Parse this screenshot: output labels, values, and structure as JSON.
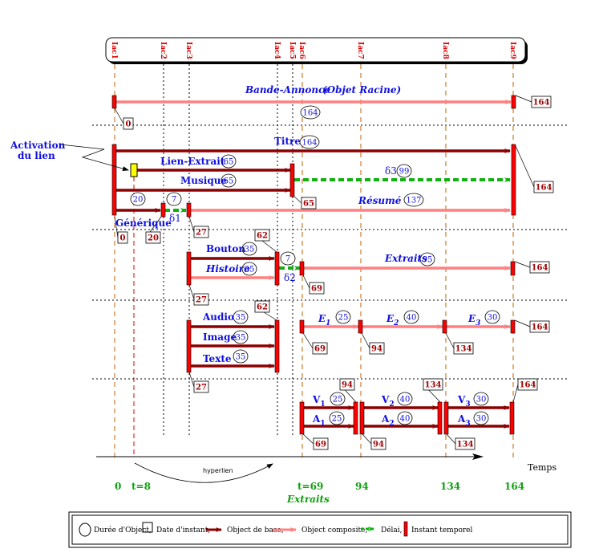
{
  "timeline": {
    "iac": [
      "Iac1",
      "Iac2",
      "Iac3",
      "Iac4",
      "Iac5",
      "Iac6",
      "Iac7",
      "Iac8",
      "Iac9"
    ]
  },
  "objects": {
    "bande_annonce": "Bande-Annonce",
    "racine": "(Objet Racine)",
    "activation": [
      "Activation",
      "du lien"
    ],
    "titre": "Titre",
    "lien_extrait": "Lien-Extrait",
    "musique": "Musique",
    "generique": "Générique",
    "resume": "Résumé",
    "bouton": "Bouton",
    "histoire": "Histoire",
    "extraits": "Extraits",
    "audio": "Audio",
    "image": "Image",
    "texte": "Texte",
    "e": [
      {
        "base": "E",
        "sub": "1"
      },
      {
        "base": "E",
        "sub": "2"
      },
      {
        "base": "E",
        "sub": "3"
      }
    ],
    "v": [
      {
        "base": "V",
        "sub": "1"
      },
      {
        "base": "V",
        "sub": "2"
      },
      {
        "base": "V",
        "sub": "3"
      }
    ],
    "a": [
      {
        "base": "A",
        "sub": "1"
      },
      {
        "base": "A",
        "sub": "2"
      },
      {
        "base": "A",
        "sub": "3"
      }
    ]
  },
  "delays": [
    "δ1",
    "δ2",
    "δ3"
  ],
  "durations": [
    "164",
    "164",
    "65",
    "65",
    "99",
    "20",
    "7",
    "137",
    "35",
    "35",
    "7",
    "95",
    "35",
    "35",
    "35",
    "25",
    "40",
    "30",
    "25",
    "25",
    "40",
    "40",
    "30",
    "30"
  ],
  "dates": [
    "0",
    "164",
    "164",
    "65",
    "0",
    "20",
    "27",
    "62",
    "27",
    "69",
    "164",
    "62",
    "27",
    "69",
    "94",
    "134",
    "164",
    "94",
    "134",
    "164",
    "69",
    "94",
    "134"
  ],
  "axis": {
    "label": "Temps",
    "ticks": [
      "0",
      "t=8",
      "t=69",
      "94",
      "134",
      "164"
    ],
    "hyperlink": "hyperlien",
    "extraits_note": "Extraits"
  },
  "legend": {
    "duration": "Durée d'Object,",
    "instant_date": "Date d'instant,",
    "base_object": "Object de base,",
    "composite_object": "Object composite,",
    "delay": "Délai,",
    "temporal_instant": "Instant temporel"
  },
  "colors": {
    "base": "#8b0000",
    "composite": "#ff8080",
    "delay": "#10b010",
    "instant": "#ff0000",
    "label": "#1010e0",
    "iac": "#e00000",
    "guide": "#c06000"
  }
}
